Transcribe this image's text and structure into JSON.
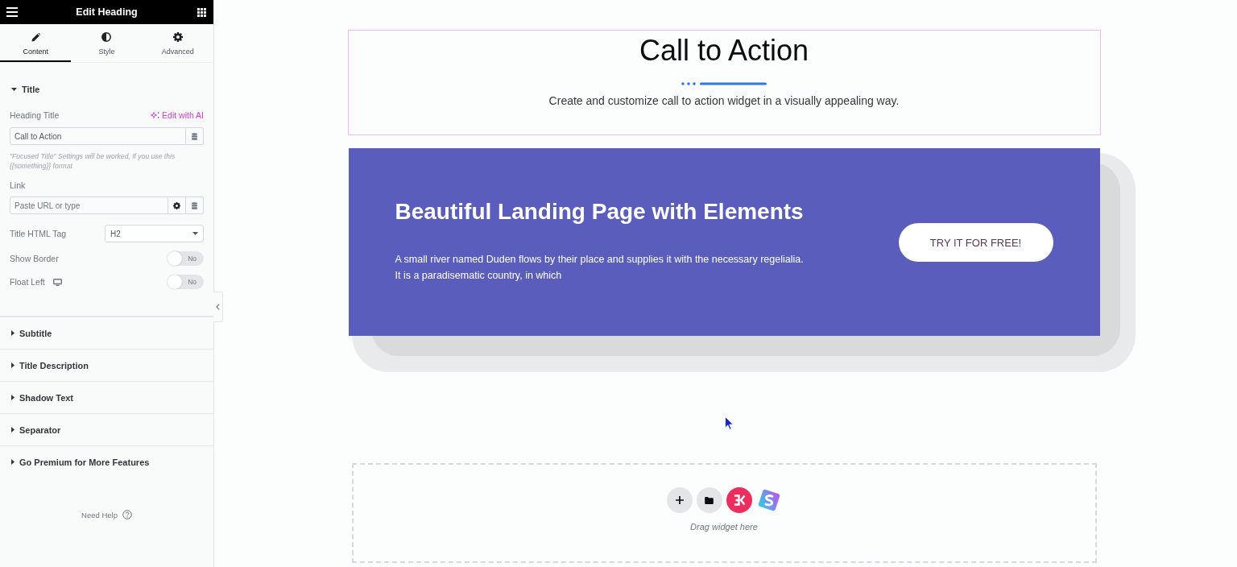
{
  "panel": {
    "header": {
      "title": "Edit Heading"
    },
    "tabs": [
      {
        "kind": "content",
        "label": "Content",
        "selected": true
      },
      {
        "kind": "style",
        "label": "Style",
        "selected": false
      },
      {
        "kind": "advanced",
        "label": "Advanced",
        "selected": false
      }
    ],
    "sections": [
      {
        "title": "Title",
        "expanded": true,
        "controls": [
          {
            "kind": "text",
            "label": "Heading Title",
            "ai_link": "Edit with AI",
            "value": "Call to Action",
            "note": "\"Focused Title\" Settings will be worked, If you use this {{something}} format"
          },
          {
            "kind": "url",
            "label": "Link",
            "placeholder": "Paste URL or type"
          },
          {
            "kind": "select",
            "label": "Title HTML Tag",
            "value": "H2"
          },
          {
            "kind": "switch",
            "label": "Show Border",
            "on": false,
            "state_text": "No"
          },
          {
            "kind": "switch",
            "label": "Float Left",
            "responsive": true,
            "on": false,
            "state_text": "No"
          }
        ]
      },
      {
        "title": "Subtitle",
        "expanded": false
      },
      {
        "title": "Title Description",
        "expanded": false
      },
      {
        "title": "Shadow Text",
        "expanded": false
      },
      {
        "title": "Separator",
        "expanded": false
      },
      {
        "title": "Go Premium for More Features",
        "expanded": false
      }
    ],
    "help": "Need Help"
  },
  "canvas": {
    "heading_widget": {
      "selected": true,
      "title": "Call to Action",
      "subtitle": "Create and customize call to action widget in a visually appealing way."
    },
    "cta": {
      "headline": "Beautiful Landing Page with Elements",
      "text": "A small river named Duden flows by their place and supplies it with the necessary regelialia. It is a paradisematic country, in which",
      "button": "TRY IT FOR FREE!"
    },
    "drop_zone": {
      "hint": "Drag widget here"
    }
  }
}
